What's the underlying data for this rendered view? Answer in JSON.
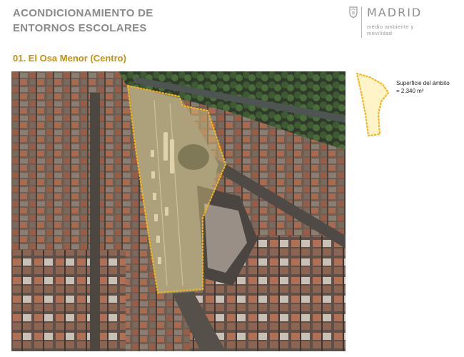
{
  "header": {
    "title_line1": "ACONDICIONAMIENTO DE",
    "title_line2": "ENTORNOS ESCOLARES",
    "logo": {
      "name": "MADRID",
      "sub_line1": "medio ambiente y",
      "sub_line2": "movilidad",
      "crest_icon": "madrid-crest-icon"
    }
  },
  "section": {
    "subtitle": "01. El Osa Menor (Centro)"
  },
  "legend": {
    "label_line1": "Superficie del ámbito",
    "label_line2": "= 2.340 m²",
    "swatch_icon": "dotted-area-outline-icon"
  },
  "colors": {
    "title_grey": "#8a8a8a",
    "accent_orange": "#c8900a",
    "area_outline": "#f2b51d",
    "area_fill": "#fff4c8"
  }
}
